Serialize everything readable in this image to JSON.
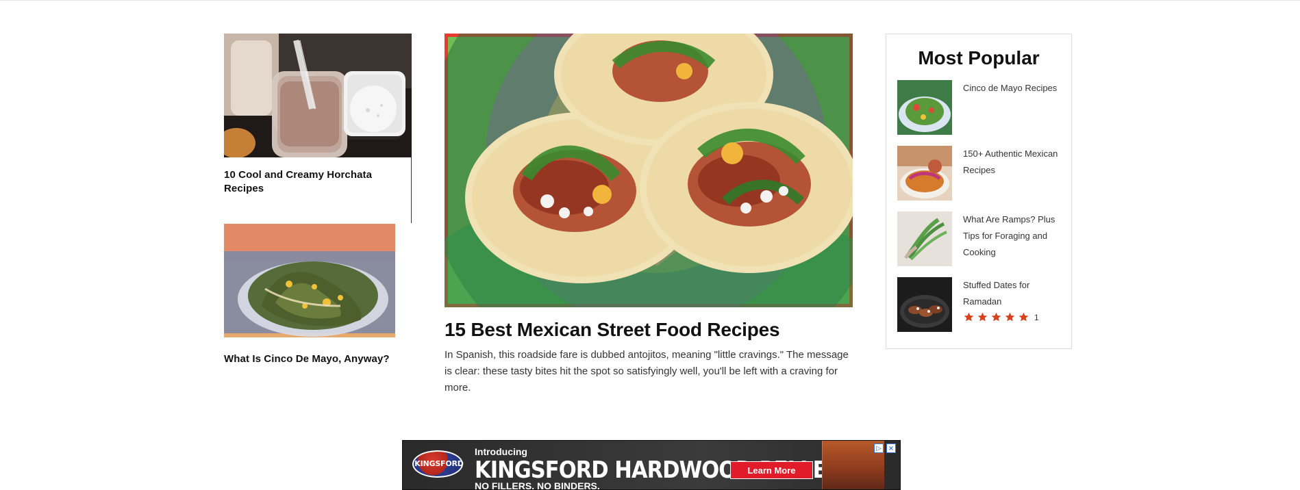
{
  "left_column": {
    "items": [
      {
        "title": "10 Cool and Creamy Horchata Recipes"
      },
      {
        "title": "What Is Cinco De Mayo, Anyway?"
      }
    ]
  },
  "feature": {
    "title": "15 Best Mexican Street Food Recipes",
    "description": "In Spanish, this roadside fare is dubbed antojitos, meaning \"little cravings.\" The message is clear: these tasty bites hit the spot so satisfyingly well, you'll be left with a craving for more."
  },
  "most_popular": {
    "title": "Most Popular",
    "items": [
      {
        "title": "Cinco de Mayo Recipes"
      },
      {
        "title": "150+ Authentic Mexican Recipes"
      },
      {
        "title": "What Are Ramps? Plus Tips for Foraging and Cooking"
      },
      {
        "title": "Stuffed Dates for Ramadan",
        "rating_stars": 5,
        "rating_count": "1"
      }
    ]
  },
  "ad": {
    "intro": "Introducing",
    "headline": "KINGSFORD HARDWOOD PELLETS",
    "subline": "NO FILLERS. NO BINDERS.",
    "cta": "Learn More",
    "logo": "KINGSFORD"
  },
  "colors": {
    "star": "#d9401e",
    "ad_button": "#e01b2a"
  }
}
